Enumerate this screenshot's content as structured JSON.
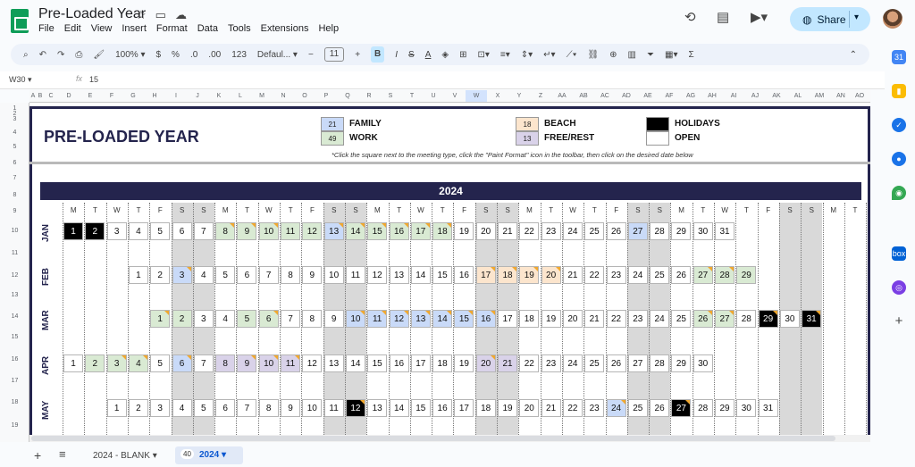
{
  "doc": {
    "title": "Pre-Loaded Year",
    "menu": [
      "File",
      "Edit",
      "View",
      "Insert",
      "Format",
      "Data",
      "Tools",
      "Extensions",
      "Help"
    ],
    "share": "Share"
  },
  "toolbar": {
    "zoom": "100%",
    "currency": "$",
    "percent": "%",
    "dec_dec": ".0",
    "inc_dec": ".00",
    "fmt123": "123",
    "font": "Defaul...",
    "size": "11",
    "bold": "B"
  },
  "formula": {
    "cell": "W30",
    "fx": "fx",
    "value": "15"
  },
  "sheet": {
    "title": "PRE-LOADED YEAR",
    "legend": [
      {
        "num": "21",
        "label": "FAMILY",
        "color": "#c9daf8"
      },
      {
        "num": "49",
        "label": "WORK",
        "color": "#d9ead3"
      },
      {
        "num": "18",
        "label": "BEACH",
        "color": "#fce5cd"
      },
      {
        "num": "13",
        "label": "FREE/REST",
        "color": "#d9d2e9"
      },
      {
        "num": "",
        "label": "HOLIDAYS",
        "color": "#000000"
      },
      {
        "num": "",
        "label": "OPEN",
        "color": "#ffffff"
      }
    ],
    "instruction": "*Click the square next to the meeting type, click the \"Paint Format\" icon in the toolbar, then click on the desired date below",
    "year": "2024",
    "weekdays": [
      "M",
      "T",
      "W",
      "T",
      "F",
      "S",
      "S",
      "M",
      "T",
      "W",
      "T",
      "F",
      "S",
      "S",
      "M",
      "T",
      "W",
      "T",
      "F",
      "S",
      "S",
      "M",
      "T",
      "W",
      "T",
      "F",
      "S",
      "S",
      "M",
      "T",
      "W",
      "T",
      "F",
      "S",
      "S",
      "M",
      "T"
    ],
    "months": [
      {
        "name": "JAN",
        "offset": 0,
        "days": 31,
        "colors": {
          "1": "#000000",
          "2": "#000000",
          "8": "#d9ead3",
          "9": "#d9ead3",
          "10": "#d9ead3",
          "11": "#d9ead3",
          "12": "#d9ead3",
          "13": "#c9daf8",
          "14": "#d9ead3",
          "15": "#d9ead3",
          "16": "#d9ead3",
          "17": "#d9ead3",
          "18": "#d9ead3",
          "27": "#c9daf8"
        },
        "tri": [
          "8",
          "9",
          "10",
          "13",
          "14",
          "15",
          "16",
          "17",
          "18"
        ]
      },
      {
        "name": "FEB",
        "offset": 3,
        "days": 29,
        "colors": {
          "3": "#c9daf8",
          "17": "#fce5cd",
          "18": "#fce5cd",
          "19": "#fce5cd",
          "20": "#fce5cd",
          "27": "#d9ead3",
          "28": "#d9ead3",
          "29": "#d9ead3"
        },
        "tri": [
          "3",
          "17",
          "18",
          "19",
          "20",
          "27",
          "28"
        ]
      },
      {
        "name": "MAR",
        "offset": 4,
        "days": 31,
        "colors": {
          "1": "#d9ead3",
          "2": "#d9ead3",
          "5": "#d9ead3",
          "6": "#d9ead3",
          "10": "#c9daf8",
          "11": "#c9daf8",
          "12": "#c9daf8",
          "13": "#c9daf8",
          "14": "#c9daf8",
          "15": "#c9daf8",
          "16": "#c9daf8",
          "26": "#d9ead3",
          "27": "#d9ead3",
          "29": "#000000",
          "31": "#000000"
        },
        "tri": [
          "1",
          "6",
          "10",
          "11",
          "12",
          "13",
          "14",
          "15",
          "16",
          "26",
          "27",
          "29",
          "31"
        ]
      },
      {
        "name": "APR",
        "offset": 0,
        "days": 30,
        "colors": {
          "2": "#d9ead3",
          "3": "#d9ead3",
          "4": "#d9ead3",
          "6": "#c9daf8",
          "8": "#d9d2e9",
          "9": "#d9d2e9",
          "10": "#d9d2e9",
          "11": "#d9d2e9",
          "20": "#d9d2e9",
          "21": "#d9d2e9"
        },
        "tri": [
          "3",
          "4",
          "6",
          "9",
          "10",
          "11",
          "20"
        ]
      },
      {
        "name": "MAY",
        "offset": 2,
        "days": 31,
        "colors": {
          "12": "#000000",
          "24": "#c9daf8",
          "27": "#000000"
        },
        "tri": [
          "12",
          "24",
          "27"
        ]
      }
    ]
  },
  "cols": [
    "A",
    "B",
    "C",
    "D",
    "E",
    "F",
    "G",
    "H",
    "I",
    "J",
    "K",
    "L",
    "M",
    "N",
    "O",
    "P",
    "Q",
    "R",
    "S",
    "T",
    "U",
    "V",
    "W",
    "X",
    "Y",
    "Z",
    "AA",
    "AB",
    "AC",
    "AD",
    "AE",
    "AF",
    "AG",
    "AH",
    "AI",
    "AJ",
    "AK",
    "AL",
    "AM",
    "AN",
    "AO"
  ],
  "rows": [
    "1",
    "2",
    "3",
    "4",
    "5",
    "6",
    "7",
    "8",
    "9",
    "10",
    "11",
    "12",
    "13",
    "14",
    "15",
    "16",
    "17",
    "18",
    "19"
  ],
  "tabs": {
    "sheet1": "2024 - BLANK",
    "sheet2": "2024",
    "badge": "40"
  }
}
